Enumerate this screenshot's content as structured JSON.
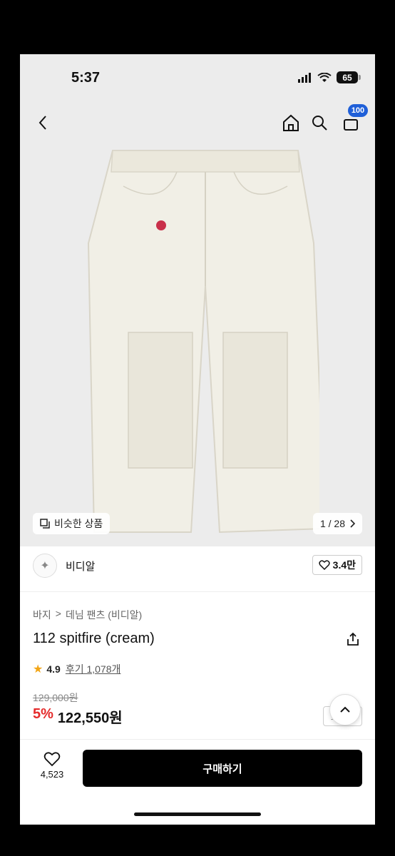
{
  "status_bar": {
    "time": "5:37",
    "battery": "65"
  },
  "nav": {
    "cart_badge": "100"
  },
  "gallery": {
    "similar_label": "비슷한 상품",
    "counter": "1 / 28"
  },
  "brand": {
    "name": "비디알",
    "likes": "3.4만"
  },
  "product": {
    "breadcrumb": [
      "바지",
      "데님 팬츠 (비디알)"
    ],
    "title": "112 spitfire (cream)",
    "rating": "4.9",
    "reviews": "후기 1,078개",
    "original_price": "129,000원",
    "discount": "5%",
    "price": "122,550원",
    "coupon_label": "쿠폰"
  },
  "bottom_bar": {
    "wish_count": "4,523",
    "buy_label": "구매하기"
  },
  "colors": {
    "accent_badge": "#1f5fd8",
    "discount": "#e52b2b",
    "buy_button": "#000000"
  }
}
